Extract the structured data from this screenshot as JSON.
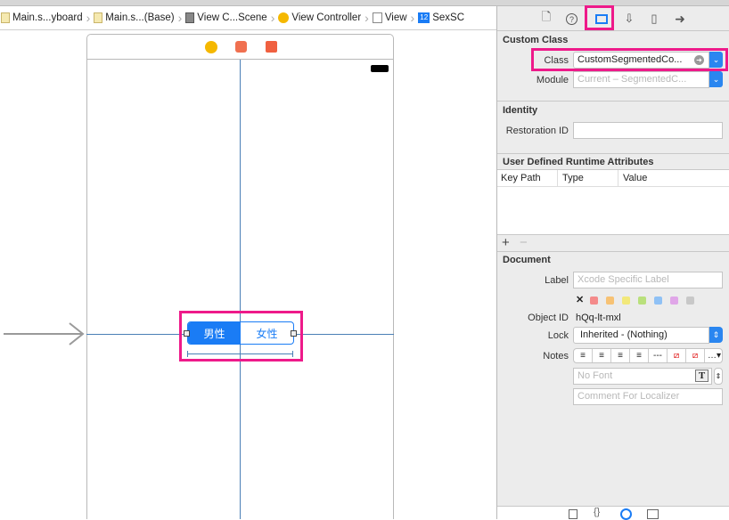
{
  "breadcrumbs": [
    "Main.s...yboard",
    "Main.s...(Base)",
    "View C...Scene",
    "View Controller",
    "View",
    "SexSC"
  ],
  "canvas": {
    "segments": [
      "男性",
      "女性"
    ],
    "selected_segment": 0
  },
  "inspector": {
    "tabs": [
      "file-icon",
      "help-icon",
      "identity-icon",
      "attributes-icon",
      "size-icon",
      "connections-icon"
    ],
    "active_tab": "identity-icon",
    "custom_class": {
      "title": "Custom Class",
      "class_label": "Class",
      "class_value": "CustomSegmentedCo...",
      "module_label": "Module",
      "module_placeholder": "Current – SegmentedC..."
    },
    "identity": {
      "title": "Identity",
      "restoration_label": "Restoration ID",
      "restoration_value": ""
    },
    "runtime": {
      "title": "User Defined Runtime Attributes",
      "columns": [
        "Key Path",
        "Type",
        "Value"
      ],
      "add": "+",
      "remove": "−"
    },
    "document": {
      "title": "Document",
      "label_label": "Label",
      "label_placeholder": "Xcode Specific Label",
      "clear": "✕",
      "colors": [
        "#f48a8a",
        "#f7c274",
        "#f2e87a",
        "#b9e07c",
        "#8fc1f5",
        "#e0a6e8",
        "#c8c8c8"
      ],
      "object_id_label": "Object ID",
      "object_id": "hQq-lt-mxl",
      "lock_label": "Lock",
      "lock_value": "Inherited - (Nothing)",
      "notes_label": "Notes",
      "font_placeholder": "No Font",
      "comment_placeholder": "Comment For Localizer"
    }
  },
  "highlight_color": "#ee1a8a",
  "accent": "#1a7cf5"
}
